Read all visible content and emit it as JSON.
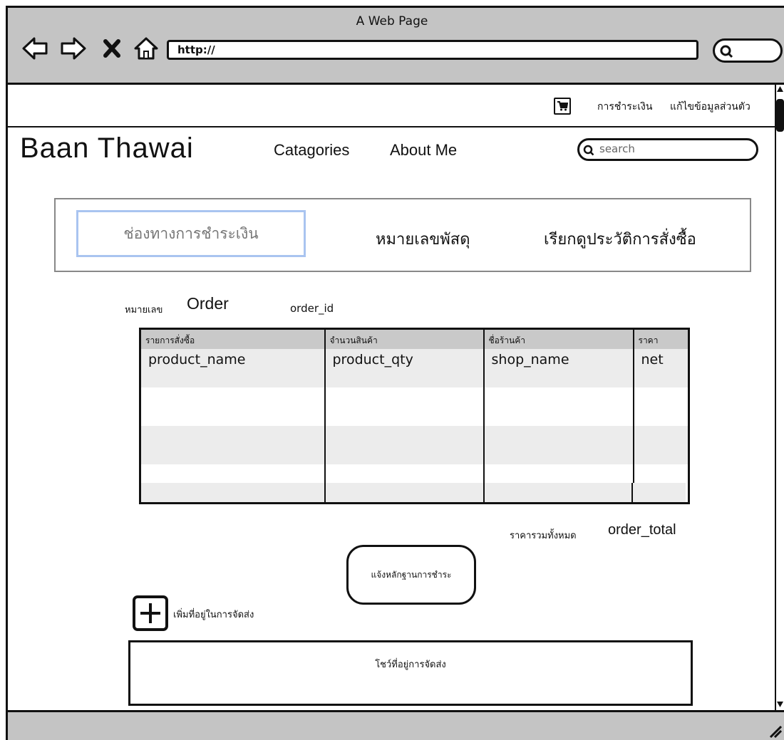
{
  "browser": {
    "window_title": "A Web Page",
    "url": "http://"
  },
  "topbar": {
    "links": [
      "การชำระเงิน",
      "แก้ไขข้อมูลส่วนตัว"
    ]
  },
  "site": {
    "brand": "Baan Thawai",
    "nav": [
      "Catagories",
      "About Me"
    ],
    "search_placeholder": "search"
  },
  "tabs": [
    "ช่องทางการชำระเงิน",
    "หมายเลขพัสดุ",
    "เรียกดูประวัติการสั่งซื้อ"
  ],
  "order": {
    "prefix": "หมายเลข",
    "label": "Order",
    "id": "order_id"
  },
  "table": {
    "headers": [
      "รายการสั่งซื้อ",
      "จำนวนสินค้า",
      "ชื่อร้านค้า",
      "ราคา"
    ],
    "rows": [
      [
        "product_name",
        "product_qty",
        "shop_name",
        "net"
      ],
      [
        "",
        "",
        "",
        ""
      ],
      [
        "",
        "",
        "",
        ""
      ],
      [
        "",
        "",
        "",
        ""
      ]
    ]
  },
  "total": {
    "label": "ราคารวมทั้งหมด",
    "value": "order_total"
  },
  "notify_button": "แจ้งหลักฐานการชำระ",
  "add_address": "เพิ่มที่อยู่ในการจัดส่ง",
  "address_box": "โชว์ที่อยู่การจัดส่ง"
}
